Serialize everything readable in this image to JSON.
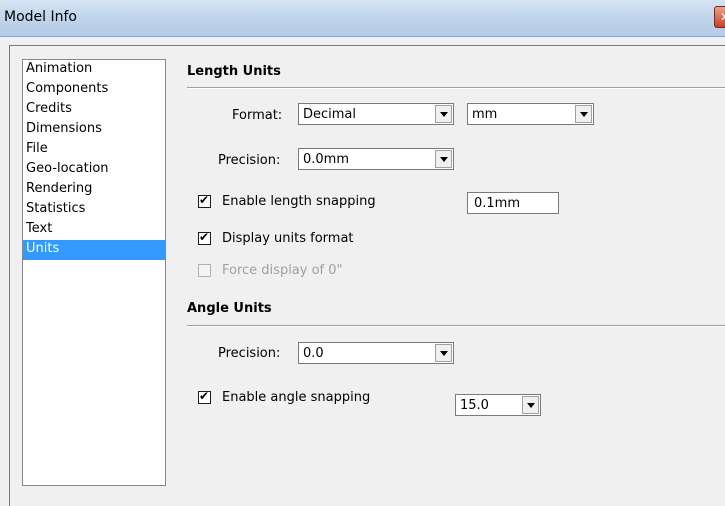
{
  "window": {
    "title": "Model Info",
    "close_glyph": "✕"
  },
  "nav": {
    "items": [
      "Animation",
      "Components",
      "Credits",
      "Dimensions",
      "File",
      "Geo-location",
      "Rendering",
      "Statistics",
      "Text",
      "Units"
    ],
    "selected": "Units"
  },
  "length_units": {
    "heading": "Length Units",
    "format_label": "Format:",
    "format_value": "Decimal",
    "unit_value": "mm",
    "precision_label": "Precision:",
    "precision_value": "0.0mm",
    "enable_snapping_label": "Enable length snapping",
    "enable_snapping_checked": true,
    "snapping_value": "0.1mm",
    "display_units_label": "Display units format",
    "display_units_checked": true,
    "force_display_label": "Force display of 0\"",
    "force_display_checked": false
  },
  "angle_units": {
    "heading": "Angle Units",
    "precision_label": "Precision:",
    "precision_value": "0.0",
    "enable_snapping_label": "Enable angle snapping",
    "enable_snapping_checked": true,
    "snapping_value": "15.0"
  }
}
